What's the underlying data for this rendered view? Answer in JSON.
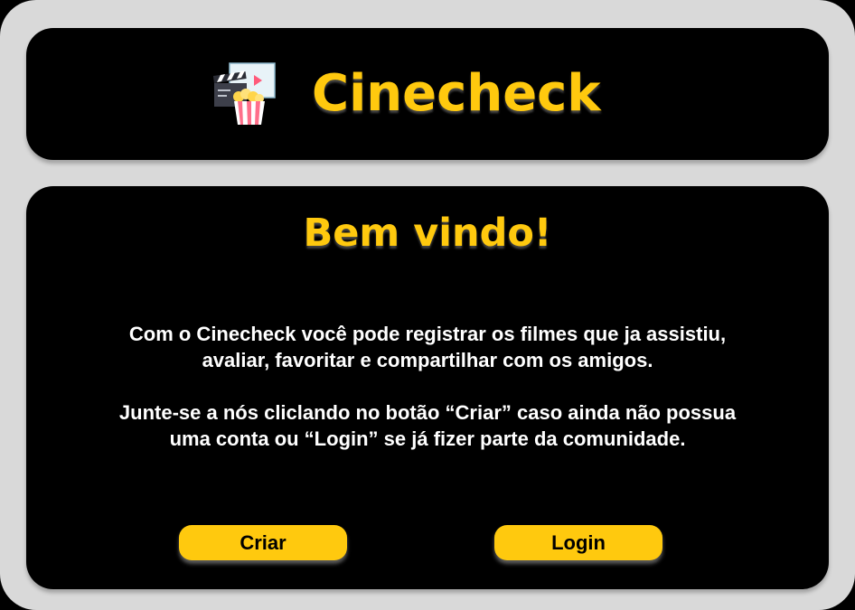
{
  "header": {
    "logo_icon": "clapperboard-popcorn-icon",
    "title": "Cinecheck"
  },
  "main": {
    "heading": "Bem vindo!",
    "paragraph_1_line_1": "Com o Cinecheck você pode registrar os filmes que ja assistiu,",
    "paragraph_1_line_2": "avaliar, favoritar e compartilhar com os amigos.",
    "paragraph_2_line_1": "Junte-se a nós cliclando no botão “Criar” caso ainda não possua",
    "paragraph_2_line_2": "uma conta ou “Login” se já fizer parte da comunidade.",
    "buttons": {
      "create_label": "Criar",
      "login_label": "Login"
    }
  },
  "colors": {
    "accent": "#FFC90E",
    "card_background": "#000000",
    "page_background": "#D9D9D9",
    "text": "#FFFFFF"
  }
}
